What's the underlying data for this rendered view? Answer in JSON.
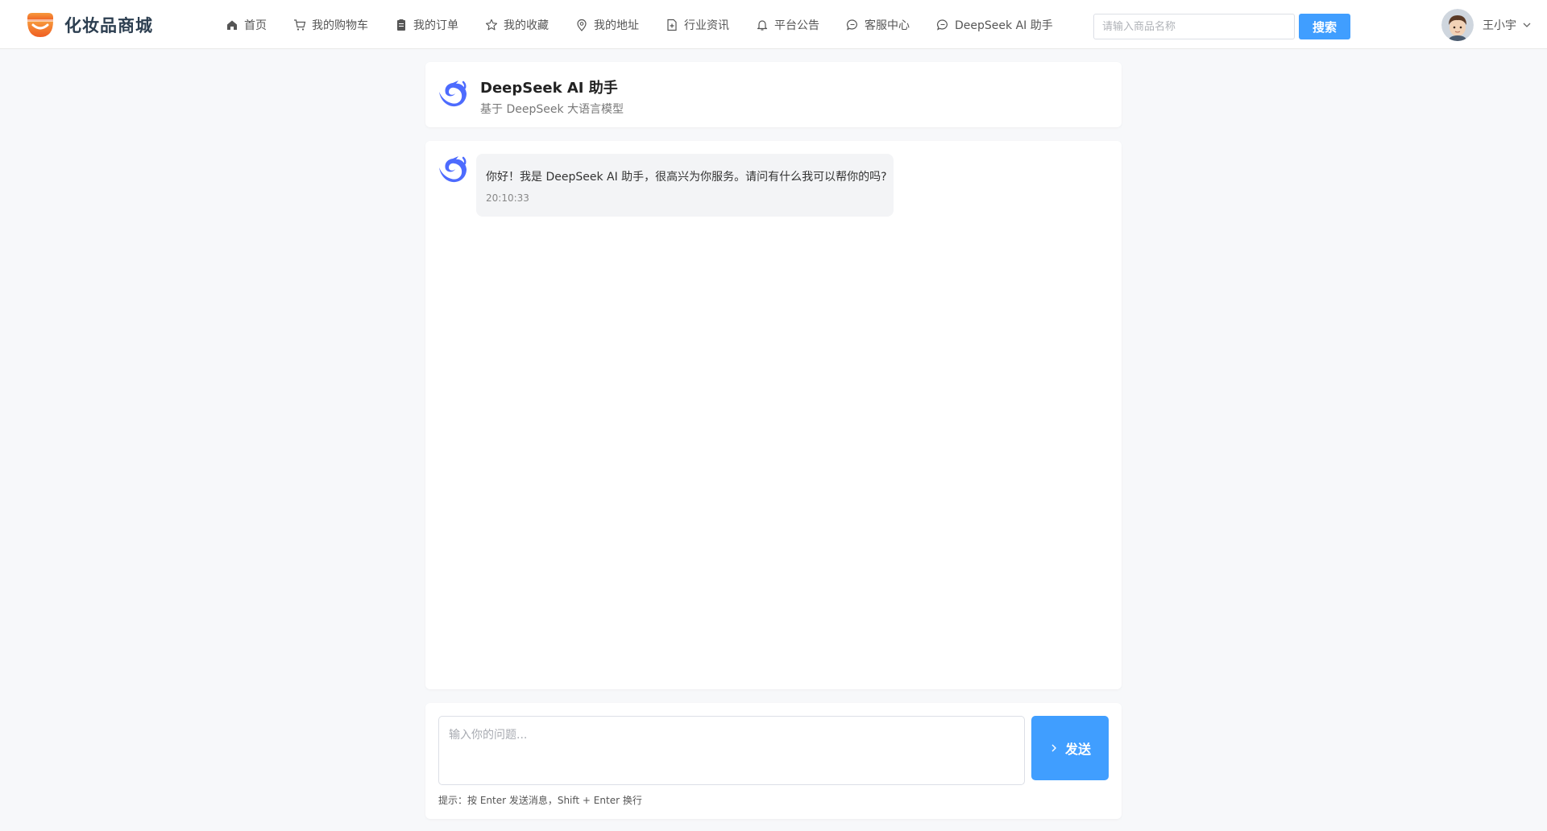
{
  "app": {
    "name": "化妆品商城",
    "logo_icon": "shop-logo-icon"
  },
  "nav": {
    "items": [
      {
        "label": "首页",
        "icon": "home-icon"
      },
      {
        "label": "我的购物车",
        "icon": "cart-icon"
      },
      {
        "label": "我的订单",
        "icon": "order-icon"
      },
      {
        "label": "我的收藏",
        "icon": "star-icon"
      },
      {
        "label": "我的地址",
        "icon": "location-icon"
      },
      {
        "label": "行业资讯",
        "icon": "document-icon"
      },
      {
        "label": "平台公告",
        "icon": "bell-icon"
      },
      {
        "label": "客服中心",
        "icon": "chat-icon"
      },
      {
        "label": "DeepSeek AI 助手",
        "icon": "chat-icon"
      }
    ]
  },
  "search": {
    "placeholder": "请输入商品名称",
    "value": "",
    "button_label": "搜索"
  },
  "user": {
    "name": "王小宇",
    "avatar": "user-avatar"
  },
  "assistant": {
    "title": "DeepSeek AI 助手",
    "subtitle": "基于 DeepSeek 大语言模型"
  },
  "messages": [
    {
      "role": "assistant",
      "text": "你好！我是 DeepSeek AI 助手，很高兴为你服务。请问有什么我可以帮你的吗?",
      "time": "20:10:33"
    }
  ],
  "composer": {
    "placeholder": "输入你的问题...",
    "value": "",
    "send_label": "发送",
    "hint": "提示：按 Enter 发送消息，Shift + Enter 换行"
  },
  "colors": {
    "accent": "#409eff",
    "ai_brand": "#4d6bfe",
    "logo_orange": "#f47a2c",
    "page_bg": "#f7f8fa",
    "bubble_bg": "#f3f4f6"
  }
}
